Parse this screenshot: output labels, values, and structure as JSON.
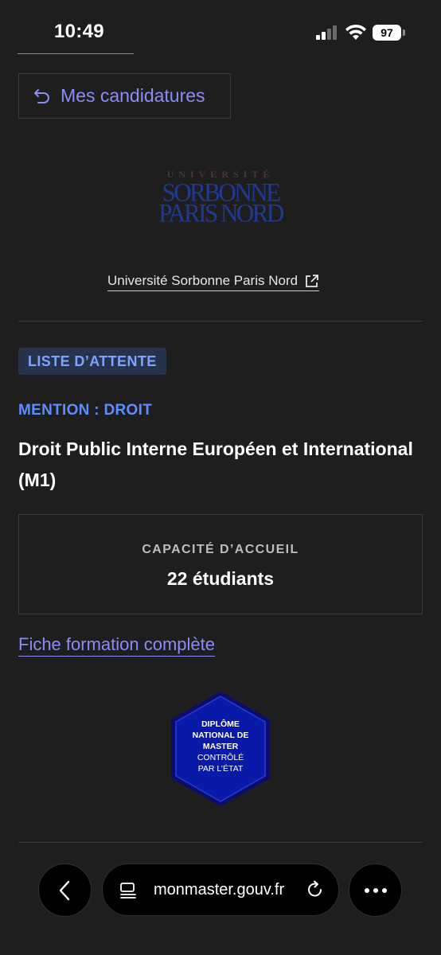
{
  "status_bar": {
    "time": "10:49",
    "battery": "97"
  },
  "back_button": {
    "label": "Mes candidatures"
  },
  "logo": {
    "top_text": "UNIVERSITÉ",
    "line1": "SORBONNE",
    "line2": "PARIS NORD"
  },
  "university_link": {
    "label": "Université Sorbonne Paris Nord"
  },
  "status_badge": "LISTE D’ATTENTE",
  "mention": "MENTION : DROIT",
  "formation_title": "Droit Public Interne Européen et International (M1)",
  "capacity": {
    "label": "CAPACITÉ D’ACCUEIL",
    "value": "22 étudiants"
  },
  "fiche_link": "Fiche formation complète",
  "diploma_badge": {
    "line1": "DIPLÔME",
    "line2": "NATIONAL DE",
    "line3": "MASTER",
    "line4": "CONTRÔLÉ",
    "line5": "PAR L’ÉTAT"
  },
  "browser": {
    "url": "monmaster.gouv.fr"
  },
  "colors": {
    "background": "#1e1e1e",
    "accent_link": "#8b8cf5",
    "mention_blue": "#5e8dff",
    "badge_bg": "#27334d",
    "badge_text": "#7fa3ff",
    "diploma_blue": "#0a1aa8"
  },
  "icons": {
    "back": "undo-arrow-icon",
    "external": "external-link-icon",
    "nav_back": "chevron-left-icon",
    "tabs": "tab-list-icon",
    "reload": "reload-icon",
    "more": "more-dots-icon"
  }
}
